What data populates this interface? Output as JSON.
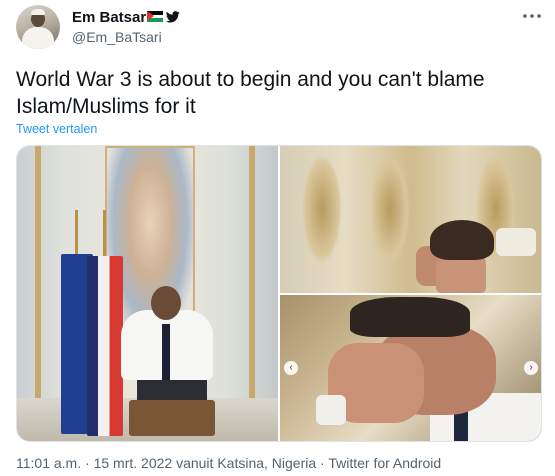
{
  "author": {
    "display_name": "Em Batsari",
    "handle": "@Em_BaTsari",
    "badges": [
      "palestine-flag",
      "twitter-bird-icon"
    ]
  },
  "tweet": {
    "text": "World War 3 is about to begin and you can't blame Islam/Muslims for it",
    "translate_label": "Tweet vertalen"
  },
  "media": {
    "count": 3,
    "prev_arrow": "‹",
    "next_arrow": "›"
  },
  "footer": {
    "time": "11:01 a.m.",
    "date": "15 mrt. 2022",
    "location": "vanuit Katsina, Nigeria",
    "client": "Twitter for Android",
    "full": "11:01 a.m. · 15 mrt. 2022 vanuit Katsina, Nigeria · Twitter for Android"
  },
  "colors": {
    "link": "#1d9bf0",
    "secondary_text": "#536471",
    "primary_text": "#0f1419"
  }
}
